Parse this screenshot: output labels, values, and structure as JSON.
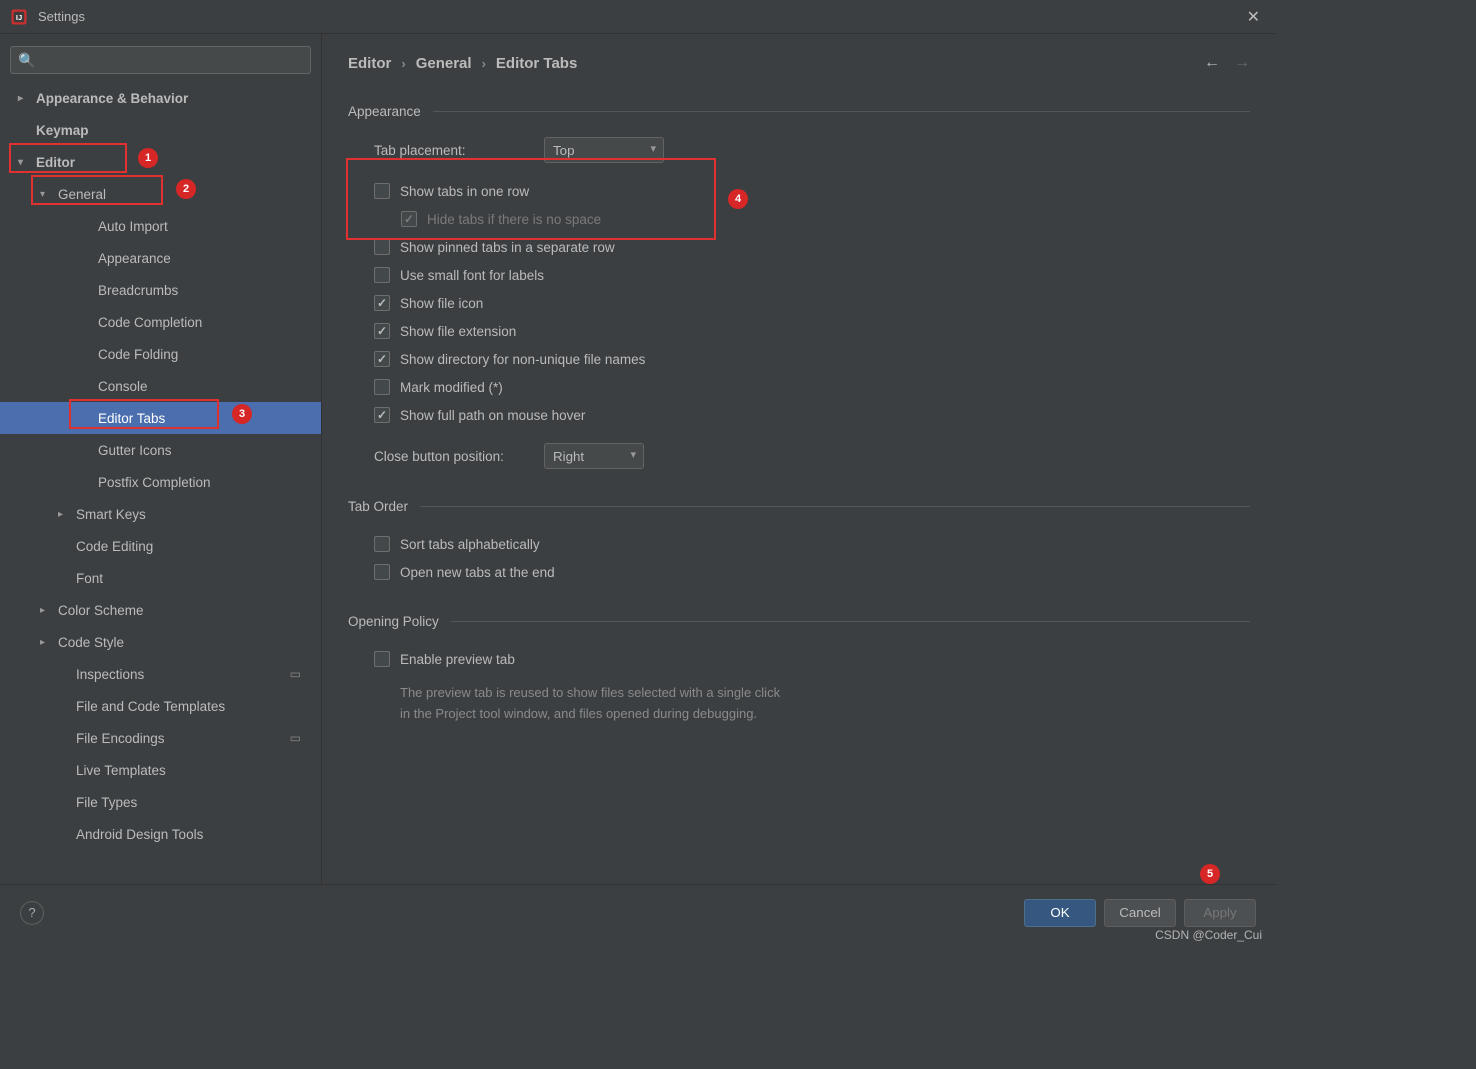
{
  "window": {
    "title": "Settings"
  },
  "search": {
    "placeholder": ""
  },
  "sidebar": [
    {
      "label": "Appearance & Behavior",
      "level": "level1",
      "arrow": "right",
      "bold": true
    },
    {
      "label": "Keymap",
      "level": "level1",
      "arrow": "none",
      "bold": true,
      "pad": true
    },
    {
      "label": "Editor",
      "level": "level1",
      "arrow": "down",
      "bold": true
    },
    {
      "label": "General",
      "level": "level2",
      "arrow": "down"
    },
    {
      "label": "Auto Import",
      "level": "level3",
      "arrow": "none"
    },
    {
      "label": "Appearance",
      "level": "level3",
      "arrow": "none"
    },
    {
      "label": "Breadcrumbs",
      "level": "level3",
      "arrow": "none"
    },
    {
      "label": "Code Completion",
      "level": "level3",
      "arrow": "none"
    },
    {
      "label": "Code Folding",
      "level": "level3",
      "arrow": "none"
    },
    {
      "label": "Console",
      "level": "level3",
      "arrow": "none"
    },
    {
      "label": "Editor Tabs",
      "level": "level3",
      "arrow": "none",
      "selected": true
    },
    {
      "label": "Gutter Icons",
      "level": "level3",
      "arrow": "none"
    },
    {
      "label": "Postfix Completion",
      "level": "level3",
      "arrow": "none"
    },
    {
      "label": "Smart Keys",
      "level": "level2b",
      "arrow": "right"
    },
    {
      "label": "Code Editing",
      "level": "level2b",
      "arrow": "none"
    },
    {
      "label": "Font",
      "level": "level2b",
      "arrow": "none"
    },
    {
      "label": "Color Scheme",
      "level": "level2",
      "arrow": "right"
    },
    {
      "label": "Code Style",
      "level": "level2",
      "arrow": "right"
    },
    {
      "label": "Inspections",
      "level": "level2b",
      "arrow": "none",
      "proj": true
    },
    {
      "label": "File and Code Templates",
      "level": "level2b",
      "arrow": "none"
    },
    {
      "label": "File Encodings",
      "level": "level2b",
      "arrow": "none",
      "proj": true
    },
    {
      "label": "Live Templates",
      "level": "level2b",
      "arrow": "none"
    },
    {
      "label": "File Types",
      "level": "level2b",
      "arrow": "none"
    },
    {
      "label": "Android Design Tools",
      "level": "level2b",
      "arrow": "none"
    }
  ],
  "breadcrumb": {
    "c1": "Editor",
    "c2": "General",
    "c3": "Editor Tabs"
  },
  "sections": {
    "appearance": {
      "title": "Appearance",
      "tab_placement_label": "Tab placement:",
      "tab_placement_value": "Top",
      "checks": [
        {
          "label": "Show tabs in one row",
          "checked": false
        },
        {
          "label": "Hide tabs if there is no space",
          "checked": true,
          "disabled": true,
          "indent": true
        },
        {
          "label": "Show pinned tabs in a separate row",
          "checked": false
        },
        {
          "label": "Use small font for labels",
          "checked": false
        },
        {
          "label": "Show file icon",
          "checked": true
        },
        {
          "label": "Show file extension",
          "checked": true
        },
        {
          "label": "Show directory for non-unique file names",
          "checked": true
        },
        {
          "label": "Mark modified (*)",
          "checked": false
        },
        {
          "label": "Show full path on mouse hover",
          "checked": true
        }
      ],
      "close_btn_label": "Close button position:",
      "close_btn_value": "Right"
    },
    "tab_order": {
      "title": "Tab Order",
      "checks": [
        {
          "label": "Sort tabs alphabetically",
          "checked": false
        },
        {
          "label": "Open new tabs at the end",
          "checked": false
        }
      ]
    },
    "opening": {
      "title": "Opening Policy",
      "check": {
        "label": "Enable preview tab",
        "checked": false
      },
      "desc1": "The preview tab is reused to show files selected with a single click",
      "desc2": "in the Project tool window, and files opened during debugging."
    }
  },
  "footer": {
    "ok": "OK",
    "cancel": "Cancel",
    "apply": "Apply"
  },
  "watermark": "CSDN @Coder_Cui"
}
